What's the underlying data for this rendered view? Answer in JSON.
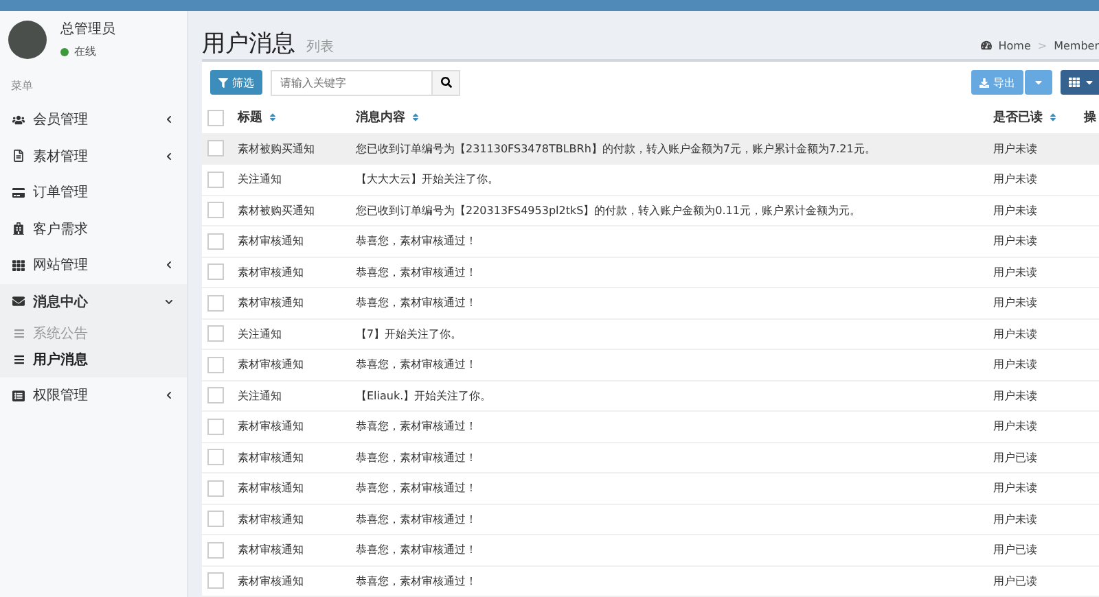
{
  "user": {
    "name": "总管理员",
    "status": "在线",
    "online": true
  },
  "menu_header": "菜单",
  "sidebar": {
    "items": [
      {
        "label": "会员管理",
        "expanded": false,
        "has_children": true
      },
      {
        "label": "素材管理",
        "expanded": false,
        "has_children": true
      },
      {
        "label": "订单管理",
        "expanded": false,
        "has_children": false
      },
      {
        "label": "客户需求",
        "expanded": false,
        "has_children": false
      },
      {
        "label": "网站管理",
        "expanded": false,
        "has_children": true
      },
      {
        "label": "消息中心",
        "expanded": true,
        "has_children": true,
        "children": [
          {
            "label": "系统公告",
            "selected": false
          },
          {
            "label": "用户消息",
            "selected": true
          }
        ]
      },
      {
        "label": "权限管理",
        "expanded": false,
        "has_children": true
      }
    ]
  },
  "page": {
    "title": "用户消息",
    "subtitle": "列表"
  },
  "breadcrumb": {
    "items": [
      "Home",
      "Member"
    ],
    "separator": ">"
  },
  "toolbar": {
    "filter_button": "筛选",
    "search": {
      "placeholder": "请输入关键字"
    },
    "export_button": "导出"
  },
  "table": {
    "select_all_checked": false,
    "columns": [
      {
        "label": "标题",
        "sortable": true
      },
      {
        "label": "消息内容",
        "sortable": true
      },
      {
        "label": "是否已读",
        "sortable": true
      },
      {
        "label": "操"
      }
    ],
    "rows": [
      {
        "title": "素材被购买通知",
        "content": "您已收到订单编号为【231130FS3478TBLBRh】的付款，转入账户金额为7元，账户累计金额为7.21元。",
        "read_status": "用户未读",
        "highlighted": true,
        "checked": false
      },
      {
        "title": "关注通知",
        "content": "【大大大云】开始关注了你。",
        "read_status": "用户未读",
        "highlighted": false,
        "checked": false
      },
      {
        "title": "素材被购买通知",
        "content": "您已收到订单编号为【220313FS4953pl2tkS】的付款，转入账户金额为0.11元，账户累计金额为元。",
        "read_status": "用户未读",
        "highlighted": false,
        "checked": false
      },
      {
        "title": "素材审核通知",
        "content": "恭喜您，素材审核通过！",
        "read_status": "用户未读",
        "highlighted": false,
        "checked": false
      },
      {
        "title": "素材审核通知",
        "content": "恭喜您，素材审核通过！",
        "read_status": "用户未读",
        "highlighted": false,
        "checked": false
      },
      {
        "title": "素材审核通知",
        "content": "恭喜您，素材审核通过！",
        "read_status": "用户未读",
        "highlighted": false,
        "checked": false
      },
      {
        "title": "关注通知",
        "content": "【7】开始关注了你。",
        "read_status": "用户未读",
        "highlighted": false,
        "checked": false
      },
      {
        "title": "素材审核通知",
        "content": "恭喜您，素材审核通过！",
        "read_status": "用户未读",
        "highlighted": false,
        "checked": false
      },
      {
        "title": "关注通知",
        "content": "【Eliauk.】开始关注了你。",
        "read_status": "用户未读",
        "highlighted": false,
        "checked": false
      },
      {
        "title": "素材审核通知",
        "content": "恭喜您，素材审核通过！",
        "read_status": "用户未读",
        "highlighted": false,
        "checked": false
      },
      {
        "title": "素材审核通知",
        "content": "恭喜您，素材审核通过！",
        "read_status": "用户已读",
        "highlighted": false,
        "checked": false
      },
      {
        "title": "素材审核通知",
        "content": "恭喜您，素材审核通过！",
        "read_status": "用户未读",
        "highlighted": false,
        "checked": false
      },
      {
        "title": "素材审核通知",
        "content": "恭喜您，素材审核通过！",
        "read_status": "用户未读",
        "highlighted": false,
        "checked": false
      },
      {
        "title": "素材审核通知",
        "content": "恭喜您，素材审核通过！",
        "read_status": "用户已读",
        "highlighted": false,
        "checked": false
      },
      {
        "title": "素材审核通知",
        "content": "恭喜您，素材审核通过！",
        "read_status": "用户已读",
        "highlighted": false,
        "checked": false
      }
    ]
  }
}
